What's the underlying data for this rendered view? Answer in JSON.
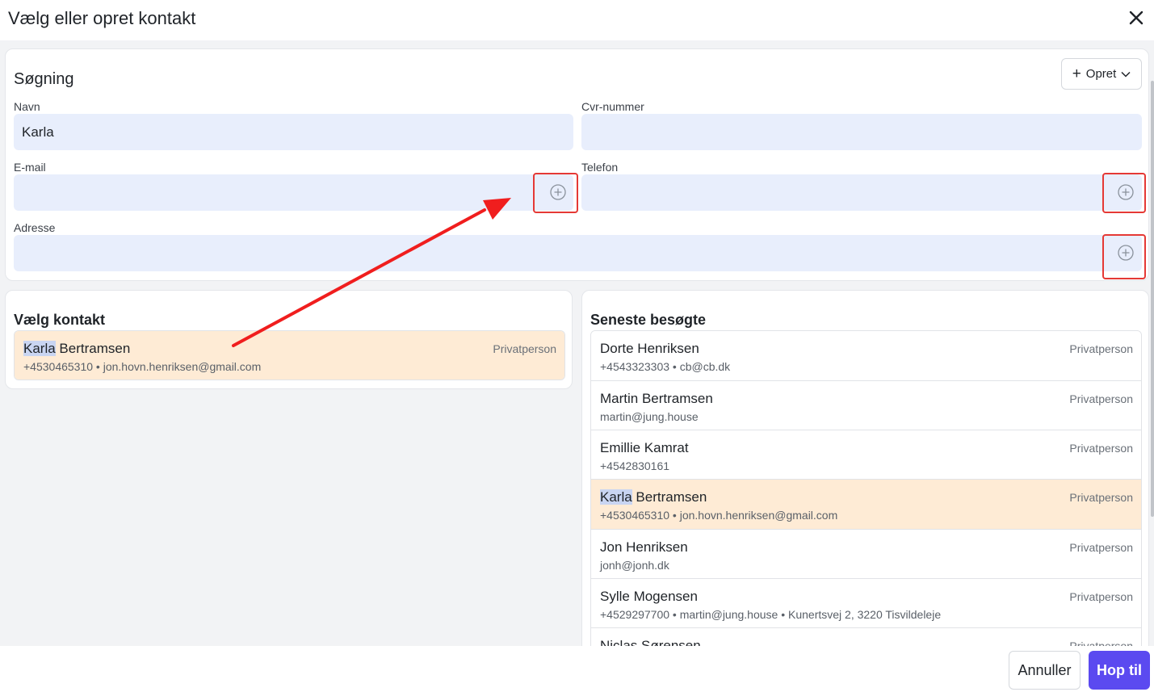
{
  "dialog": {
    "title": "Vælg eller opret kontakt",
    "close_icon": "close-icon"
  },
  "search": {
    "title": "Søgning",
    "create_label": "Opret",
    "fields": {
      "name_label": "Navn",
      "name_value": "Karla",
      "cvr_label": "Cvr-nummer",
      "cvr_value": "",
      "email_label": "E-mail",
      "email_value": "",
      "phone_label": "Telefon",
      "phone_value": "",
      "address_label": "Adresse",
      "address_value": ""
    }
  },
  "choose_contact": {
    "title": "Vælg kontakt",
    "results": [
      {
        "name_match": "Karla",
        "name_rest": " Bertramsen",
        "meta": "+4530465310 • jon.hovn.henriksen@gmail.com",
        "type": "Privatperson"
      }
    ]
  },
  "recent": {
    "title": "Seneste besøgte",
    "items": [
      {
        "name_match": "",
        "name_rest": "Dorte Henriksen",
        "meta": "+4543323303 • cb@cb.dk",
        "type": "Privatperson"
      },
      {
        "name_match": "",
        "name_rest": "Martin Bertramsen",
        "meta": "martin@jung.house",
        "type": "Privatperson"
      },
      {
        "name_match": "",
        "name_rest": "Emillie Kamrat",
        "meta": "+4542830161",
        "type": "Privatperson"
      },
      {
        "name_match": "Karla",
        "name_rest": " Bertramsen",
        "meta": "+4530465310 • jon.hovn.henriksen@gmail.com",
        "type": "Privatperson"
      },
      {
        "name_match": "",
        "name_rest": "Jon Henriksen",
        "meta": "jonh@jonh.dk",
        "type": "Privatperson"
      },
      {
        "name_match": "",
        "name_rest": "Sylle Mogensen",
        "meta": "+4529297700 • martin@jung.house • Kunertsvej 2, 3220 Tisvildeleje",
        "type": "Privatperson"
      },
      {
        "name_match": "",
        "name_rest": "Niclas Sørensen",
        "meta": "",
        "type": "Privatperson"
      }
    ]
  },
  "footer": {
    "cancel_label": "Annuller",
    "jump_label": "Hop til"
  },
  "colors": {
    "primary": "#5b4af0",
    "field_bg": "#e8eefc",
    "selected_row": "#feebd5",
    "annotation": "#e53935"
  }
}
